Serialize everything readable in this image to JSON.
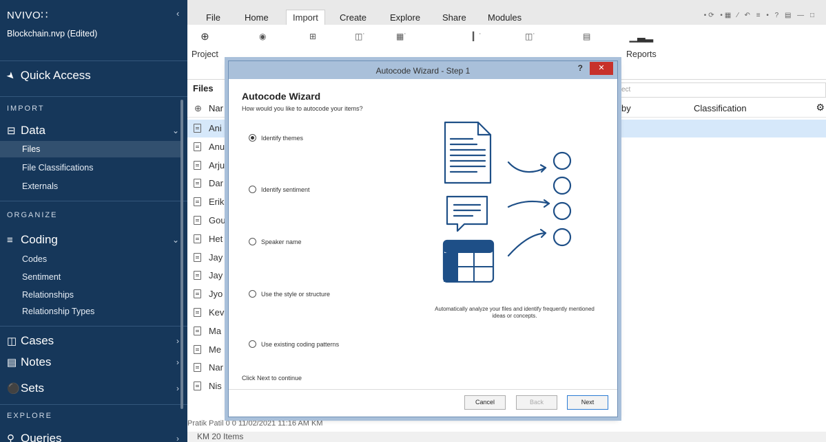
{
  "app": {
    "logo": "NVIVO",
    "logo_mark": "∷",
    "collapse": "‹",
    "project": "Blockchain.nvp (Edited)"
  },
  "sidebar": {
    "quick_access": "Quick Access",
    "sections": {
      "import": "IMPORT",
      "organize": "ORGANIZE",
      "explore": "EXPLORE"
    },
    "groups": {
      "data": "Data",
      "coding": "Coding",
      "cases": "Cases",
      "notes": "Notes",
      "sets": "Sets",
      "queries": "Queries"
    },
    "data_items": [
      "Files",
      "File Classifications",
      "Externals"
    ],
    "coding_items": [
      "Codes",
      "Sentiment",
      "Relationships",
      "Relationship Types"
    ],
    "active_item": "Files"
  },
  "ribbon": {
    "tabs": [
      "File",
      "Home",
      "Import",
      "Create",
      "Explore",
      "Share",
      "Modules"
    ],
    "active_tab": "Import",
    "project_label": "Project",
    "reports_label": "Reports"
  },
  "files": {
    "title": "Files",
    "search_placeholder": "ect",
    "columns": {
      "name": "Nar",
      "by": "by",
      "classification": "Classification"
    },
    "rows": [
      "Ani",
      "Anu",
      "Arju",
      "Dar",
      "Erik",
      "Gou",
      "Het",
      "Jay",
      "Jay",
      "Jyo",
      "Kev",
      "Ma",
      "Me",
      "Nar",
      "Nis"
    ],
    "partial_row": "Pratik Patil          0               0                         11/02/2021 11:16 AM        KM",
    "status": "KM    20 Items"
  },
  "dialog": {
    "title": "Autocode Wizard - Step 1",
    "help": "?",
    "close": "✕",
    "heading": "Autocode Wizard",
    "subheading": "How would you like to autocode your items?",
    "options": [
      "Identify themes",
      "Identify sentiment",
      "Speaker name",
      "Use the style or structure",
      "Use existing coding patterns"
    ],
    "selected_option": 0,
    "caption": "Automatically analyze your files and identify frequently mentioned ideas or concepts.",
    "footer": "Click Next to continue",
    "buttons": {
      "cancel": "Cancel",
      "back": "Back",
      "next": "Next"
    },
    "illustration_color": "#1e4f87"
  }
}
